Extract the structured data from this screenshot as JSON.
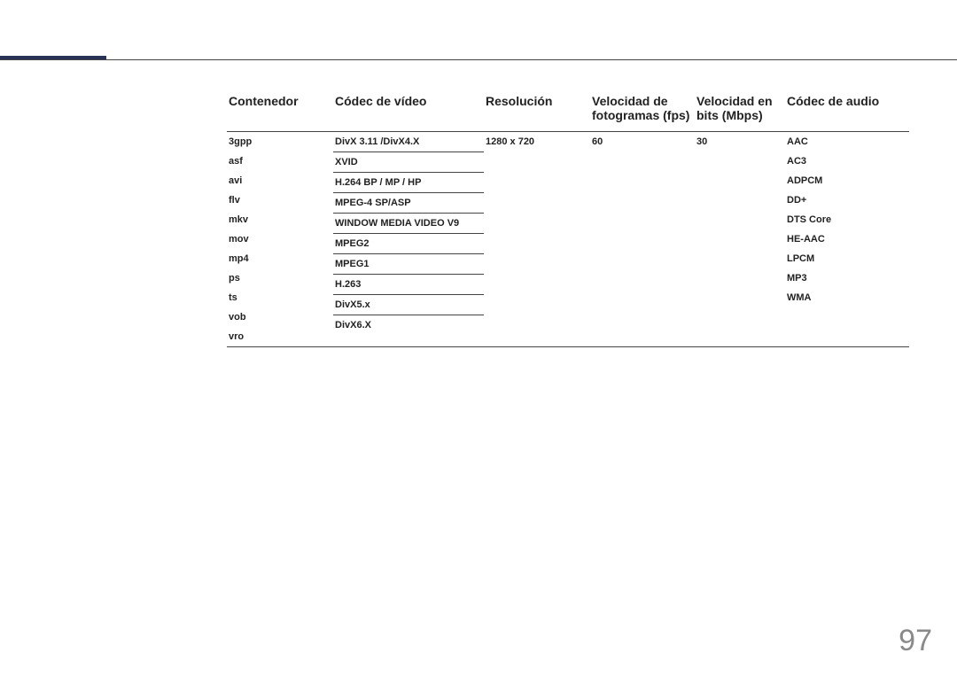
{
  "chart_data": {
    "type": "table",
    "headers": [
      "Contenedor",
      "Códec de vídeo",
      "Resolución",
      "Velocidad de fotogramas (fps)",
      "Velocidad en bits (Mbps)",
      "Códec de audio"
    ],
    "rows": [
      {
        "contenedor": [
          "3gpp",
          "asf",
          "avi",
          "flv",
          "mkv",
          "mov",
          "mp4",
          "ps",
          "ts",
          "vob",
          "vro"
        ],
        "codec_video": [
          "DivX 3.11 /DivX4.X",
          "XVID",
          "H.264 BP / MP / HP",
          "MPEG-4 SP/ASP",
          "WINDOW MEDIA VIDEO V9",
          "MPEG2",
          "MPEG1",
          "H.263",
          "DivX5.x",
          "DivX6.X"
        ],
        "resolucion": "1280 x 720",
        "fps": "60",
        "mbps": "30",
        "codec_audio": [
          "AAC",
          "AC3",
          "ADPCM",
          "DD+",
          "DTS Core",
          "HE-AAC",
          "LPCM",
          "MP3",
          "WMA"
        ]
      }
    ]
  },
  "headers": {
    "c1": "Contenedor",
    "c2": "Códec de vídeo",
    "c3": "Resolución",
    "c4": "Velocidad de fotogramas (fps)",
    "c5": "Velocidad en bits (Mbps)",
    "c6": "Códec de audio"
  },
  "containers": {
    "i0": "3gpp",
    "i1": "asf",
    "i2": "avi",
    "i3": "flv",
    "i4": "mkv",
    "i5": "mov",
    "i6": "mp4",
    "i7": "ps",
    "i8": "ts",
    "i9": "vob",
    "i10": "vro"
  },
  "vcodecs": {
    "i0": "DivX 3.11 /DivX4.X",
    "i1": "XVID",
    "i2": "H.264 BP / MP / HP",
    "i3": "MPEG-4 SP/ASP",
    "i4": "WINDOW MEDIA VIDEO V9",
    "i5": "MPEG2",
    "i6": "MPEG1",
    "i7": "H.263",
    "i8": "DivX5.x",
    "i9": "DivX6.X"
  },
  "resolution": "1280 x 720",
  "fps": "60",
  "mbps": "30",
  "acodecs": {
    "i0": "AAC",
    "i1": "AC3",
    "i2": "ADPCM",
    "i3": "DD+",
    "i4": "DTS Core",
    "i5": "HE-AAC",
    "i6": "LPCM",
    "i7": "MP3",
    "i8": "WMA"
  },
  "page_number": "97"
}
